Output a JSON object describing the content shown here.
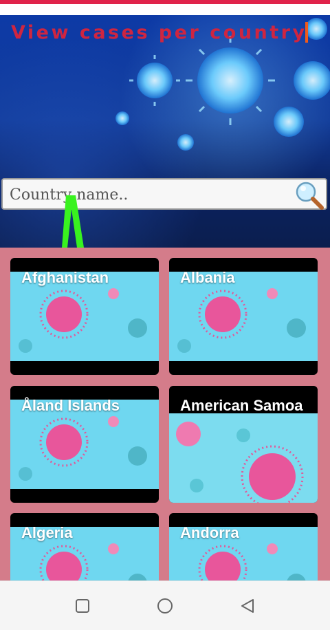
{
  "header": {
    "title": "View cases per country"
  },
  "search": {
    "placeholder": "Country name.."
  },
  "countries": [
    {
      "name": "Afghanistan"
    },
    {
      "name": "Albania"
    },
    {
      "name": "Åland Islands"
    },
    {
      "name": "American Samoa"
    },
    {
      "name": "Algeria"
    },
    {
      "name": "Andorra"
    }
  ],
  "colors": {
    "title": "#cf2540",
    "grid_background": "#d47c8a",
    "accent_strip": "#e0234a"
  },
  "icons": {
    "search": "search-icon",
    "nav_recent": "square-icon",
    "nav_home": "circle-icon",
    "nav_back": "triangle-back-icon"
  }
}
